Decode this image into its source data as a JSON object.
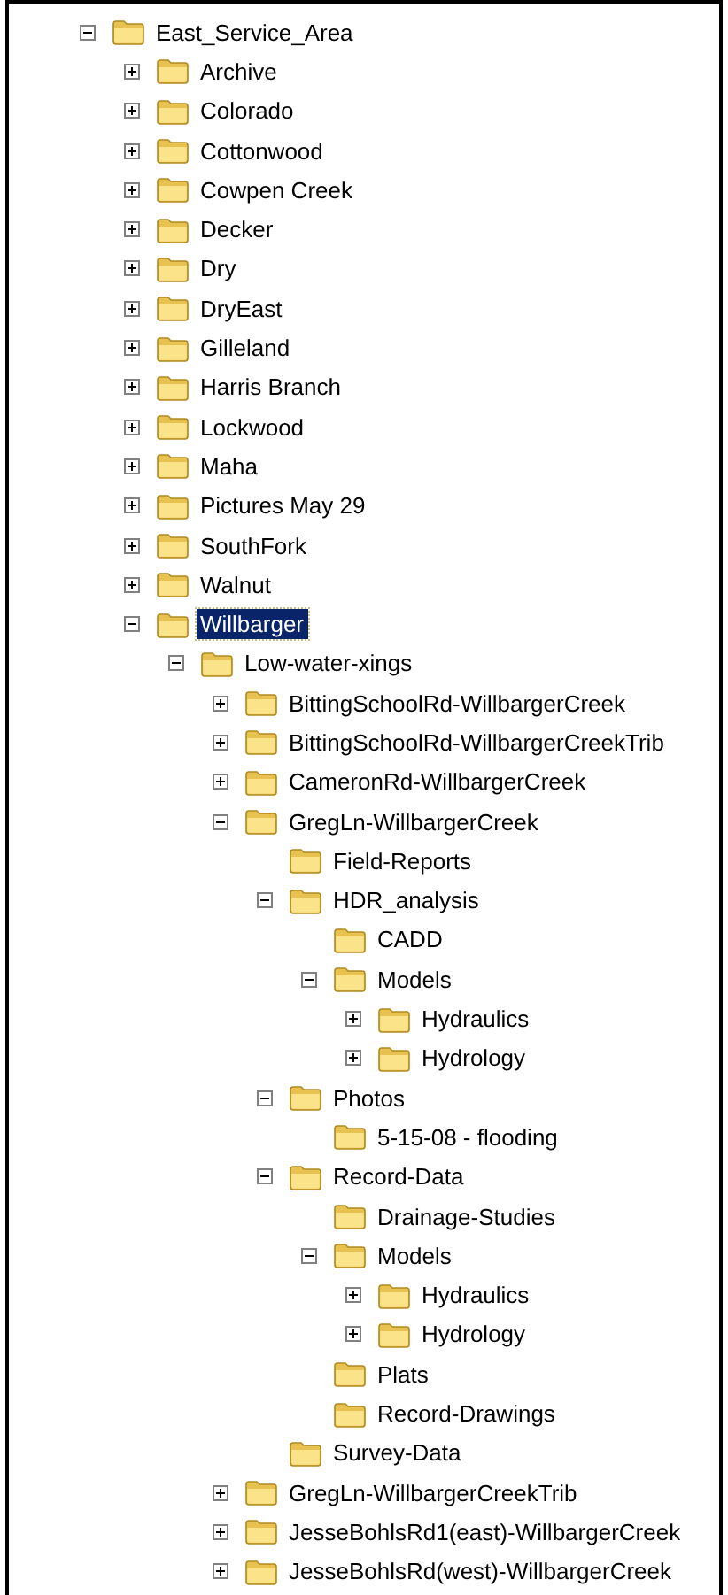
{
  "tree": [
    {
      "name": "East_Service_Area",
      "kind": "branch",
      "expanded": true,
      "selected": false,
      "children": [
        {
          "name": "Archive",
          "kind": "branch",
          "expanded": false,
          "selected": false
        },
        {
          "name": "Colorado",
          "kind": "branch",
          "expanded": false,
          "selected": false
        },
        {
          "name": "Cottonwood",
          "kind": "branch",
          "expanded": false,
          "selected": false
        },
        {
          "name": "Cowpen Creek",
          "kind": "branch",
          "expanded": false,
          "selected": false
        },
        {
          "name": "Decker",
          "kind": "branch",
          "expanded": false,
          "selected": false
        },
        {
          "name": "Dry",
          "kind": "branch",
          "expanded": false,
          "selected": false
        },
        {
          "name": "DryEast",
          "kind": "branch",
          "expanded": false,
          "selected": false
        },
        {
          "name": "Gilleland",
          "kind": "branch",
          "expanded": false,
          "selected": false
        },
        {
          "name": "Harris Branch",
          "kind": "branch",
          "expanded": false,
          "selected": false
        },
        {
          "name": "Lockwood",
          "kind": "branch",
          "expanded": false,
          "selected": false
        },
        {
          "name": "Maha",
          "kind": "branch",
          "expanded": false,
          "selected": false
        },
        {
          "name": "Pictures May 29",
          "kind": "branch",
          "expanded": false,
          "selected": false
        },
        {
          "name": "SouthFork",
          "kind": "branch",
          "expanded": false,
          "selected": false
        },
        {
          "name": "Walnut",
          "kind": "branch",
          "expanded": false,
          "selected": false
        },
        {
          "name": "Willbarger",
          "kind": "branch",
          "expanded": true,
          "selected": true,
          "children": [
            {
              "name": "Low-water-xings",
              "kind": "branch",
              "expanded": true,
              "selected": false,
              "children": [
                {
                  "name": "BittingSchoolRd-WillbargerCreek",
                  "kind": "branch",
                  "expanded": false,
                  "selected": false
                },
                {
                  "name": "BittingSchoolRd-WillbargerCreekTrib",
                  "kind": "branch",
                  "expanded": false,
                  "selected": false
                },
                {
                  "name": "CameronRd-WillbargerCreek",
                  "kind": "branch",
                  "expanded": false,
                  "selected": false
                },
                {
                  "name": "GregLn-WillbargerCreek",
                  "kind": "branch",
                  "expanded": true,
                  "selected": false,
                  "children": [
                    {
                      "name": "Field-Reports",
                      "kind": "leaf",
                      "selected": false
                    },
                    {
                      "name": "HDR_analysis",
                      "kind": "branch",
                      "expanded": true,
                      "selected": false,
                      "children": [
                        {
                          "name": "CADD",
                          "kind": "leaf",
                          "selected": false
                        },
                        {
                          "name": "Models",
                          "kind": "branch",
                          "expanded": true,
                          "selected": false,
                          "children": [
                            {
                              "name": "Hydraulics",
                              "kind": "branch",
                              "expanded": false,
                              "selected": false
                            },
                            {
                              "name": "Hydrology",
                              "kind": "branch",
                              "expanded": false,
                              "selected": false
                            }
                          ]
                        }
                      ]
                    },
                    {
                      "name": "Photos",
                      "kind": "branch",
                      "expanded": true,
                      "selected": false,
                      "children": [
                        {
                          "name": "5-15-08 - flooding",
                          "kind": "leaf",
                          "selected": false
                        }
                      ]
                    },
                    {
                      "name": "Record-Data",
                      "kind": "branch",
                      "expanded": true,
                      "selected": false,
                      "children": [
                        {
                          "name": "Drainage-Studies",
                          "kind": "leaf",
                          "selected": false
                        },
                        {
                          "name": "Models",
                          "kind": "branch",
                          "expanded": true,
                          "selected": false,
                          "children": [
                            {
                              "name": "Hydraulics",
                              "kind": "branch",
                              "expanded": false,
                              "selected": false
                            },
                            {
                              "name": "Hydrology",
                              "kind": "branch",
                              "expanded": false,
                              "selected": false
                            }
                          ]
                        },
                        {
                          "name": "Plats",
                          "kind": "leaf",
                          "selected": false
                        },
                        {
                          "name": "Record-Drawings",
                          "kind": "leaf",
                          "selected": false
                        }
                      ]
                    },
                    {
                      "name": "Survey-Data",
                      "kind": "leaf",
                      "selected": false
                    }
                  ]
                },
                {
                  "name": "GregLn-WillbargerCreekTrib",
                  "kind": "branch",
                  "expanded": false,
                  "selected": false
                },
                {
                  "name": "JesseBohlsRd1(east)-WillbargerCreek",
                  "kind": "branch",
                  "expanded": false,
                  "selected": false
                },
                {
                  "name": "JesseBohlsRd(west)-WillbargerCreek",
                  "kind": "branch",
                  "expanded": false,
                  "selected": false
                }
              ]
            }
          ]
        }
      ]
    }
  ]
}
